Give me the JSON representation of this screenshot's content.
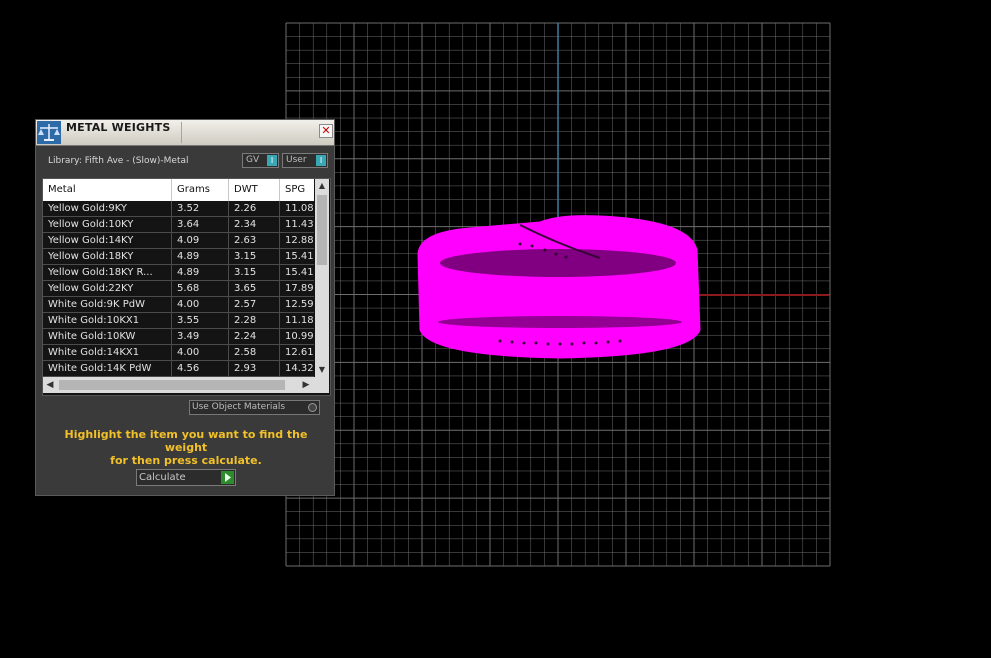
{
  "window": {
    "title": "METAL WEIGHTS",
    "close_glyph": "✕",
    "logo_icon": "balance-scale-icon"
  },
  "library": {
    "label": "Library: Fifth Ave - (Slow)-Metal"
  },
  "toggles": {
    "gv": {
      "label": "GV",
      "knob": "I"
    },
    "user": {
      "label": "User",
      "knob": "I"
    }
  },
  "table": {
    "columns": [
      "Metal",
      "Grams",
      "DWT",
      "SPG"
    ],
    "rows": [
      [
        "Yellow Gold:9KY",
        "3.52",
        "2.26",
        "11.08"
      ],
      [
        "Yellow Gold:10KY",
        "3.64",
        "2.34",
        "11.43"
      ],
      [
        "Yellow Gold:14KY",
        "4.09",
        "2.63",
        "12.88"
      ],
      [
        "Yellow Gold:18KY",
        "4.89",
        "3.15",
        "15.41"
      ],
      [
        "Yellow Gold:18KY R...",
        "4.89",
        "3.15",
        "15.41"
      ],
      [
        "Yellow Gold:22KY",
        "5.68",
        "3.65",
        "17.89"
      ],
      [
        "White Gold:9K PdW",
        "4.00",
        "2.57",
        "12.59"
      ],
      [
        "White Gold:10KX1",
        "3.55",
        "2.28",
        "11.18"
      ],
      [
        "White Gold:10KW",
        "3.49",
        "2.24",
        "10.99"
      ],
      [
        "White Gold:14KX1",
        "4.00",
        "2.58",
        "12.61"
      ],
      [
        "White Gold:14K PdW",
        "4.56",
        "2.93",
        "14.32"
      ]
    ]
  },
  "options": {
    "use_object_materials": "Use Object Materials"
  },
  "hint": {
    "line1": "Highlight the item you want to find the weight",
    "line2": "for then press calculate."
  },
  "actions": {
    "calculate_label": "Calculate"
  },
  "viewport": {
    "grid_color": "#6e6e6e",
    "x_axis_color": "#8b1a1a",
    "y_axis_color": "#3f7f9f",
    "model_color": "#ff00ff"
  }
}
